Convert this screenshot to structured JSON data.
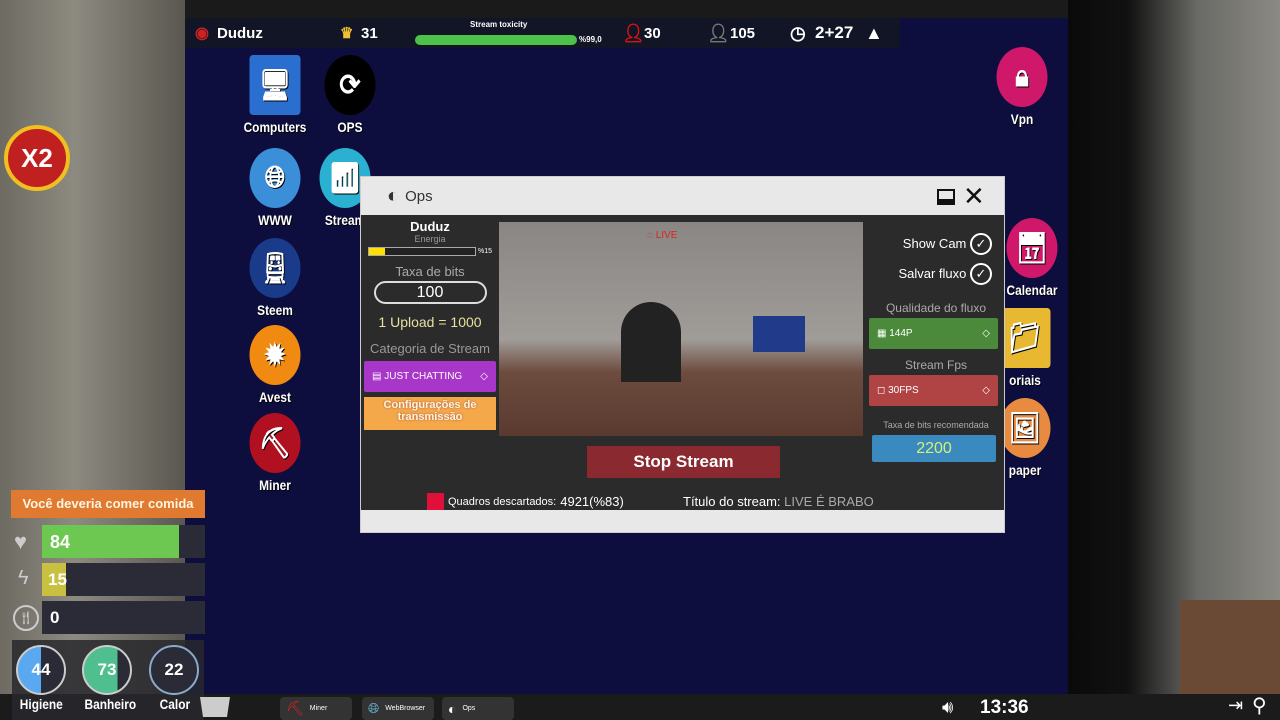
{
  "topbar": {
    "player": "Duduz",
    "crowns": "31",
    "toxicity_label": "Stream toxicity",
    "toxicity": "%99,0",
    "toxicity_fraction": 0.99,
    "red_count": "30",
    "viewers": "105",
    "timer": "2+27"
  },
  "multiplier": "X2",
  "desktop_icons": [
    "Computers",
    "OPS",
    "WWW",
    "Stream",
    "Steem",
    "Avest",
    "Miner",
    "Vpn",
    "Calendar",
    "oriais",
    "paper"
  ],
  "window": {
    "title": "Ops",
    "left": {
      "name": "Duduz",
      "energy_label": "Energia",
      "energy": "%15",
      "energy_fraction": 0.15,
      "bitrate_label": "Taxa de bits",
      "bitrate": "100",
      "upload": "1 Upload = 1000",
      "category_label": "Categoria de Stream",
      "category": "JUST CHATTING",
      "settings_button": "Configurações de transmissão"
    },
    "video": {
      "live": "LIVE"
    },
    "right": {
      "show_cam": "Show Cam",
      "save_stream": "Salvar fluxo",
      "quality_label": "Qualidade do fluxo",
      "quality": "144P",
      "fps_label": "Stream Fps",
      "fps": "30FPS",
      "recommended_label": "Taxa de bits recomendada",
      "recommended": "2200"
    },
    "stop_button": "Stop Stream",
    "dropped_label": "Quadros descartados:",
    "dropped": "4921(%83)",
    "title_label": "Título do stream:",
    "stream_title": "LIVE É BRABO"
  },
  "hud": {
    "warning": "Você deveria comer comida",
    "health": "84",
    "energy": "15",
    "food": "0",
    "rings": [
      {
        "value": "44",
        "label": "Higiene",
        "color": "#5aa9f0"
      },
      {
        "value": "73",
        "label": "Banheiro",
        "color": "#4fbf8f"
      },
      {
        "value": "22",
        "label": "Calor",
        "color": "#2a2b36"
      }
    ]
  },
  "taskbar": {
    "apps": [
      "Miner",
      "WebBrowser",
      "Ops"
    ],
    "clock": "13:36"
  }
}
